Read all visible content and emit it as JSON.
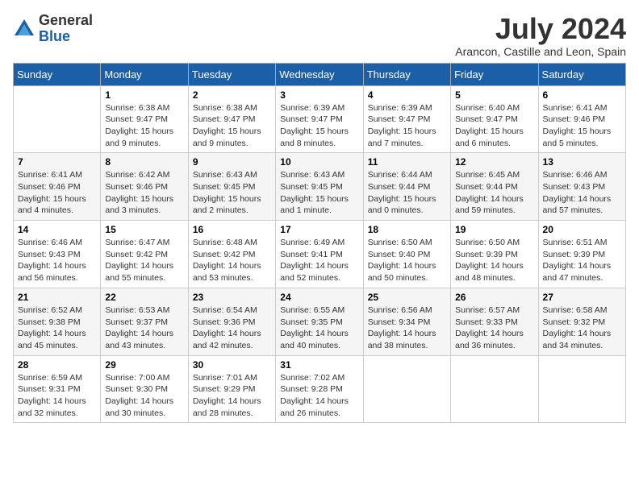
{
  "logo": {
    "general": "General",
    "blue": "Blue"
  },
  "header": {
    "month_year": "July 2024",
    "location": "Arancon, Castille and Leon, Spain"
  },
  "weekdays": [
    "Sunday",
    "Monday",
    "Tuesday",
    "Wednesday",
    "Thursday",
    "Friday",
    "Saturday"
  ],
  "weeks": [
    [
      {
        "day": "",
        "sunrise": "",
        "sunset": "",
        "daylight": ""
      },
      {
        "day": "1",
        "sunrise": "Sunrise: 6:38 AM",
        "sunset": "Sunset: 9:47 PM",
        "daylight": "Daylight: 15 hours and 9 minutes."
      },
      {
        "day": "2",
        "sunrise": "Sunrise: 6:38 AM",
        "sunset": "Sunset: 9:47 PM",
        "daylight": "Daylight: 15 hours and 9 minutes."
      },
      {
        "day": "3",
        "sunrise": "Sunrise: 6:39 AM",
        "sunset": "Sunset: 9:47 PM",
        "daylight": "Daylight: 15 hours and 8 minutes."
      },
      {
        "day": "4",
        "sunrise": "Sunrise: 6:39 AM",
        "sunset": "Sunset: 9:47 PM",
        "daylight": "Daylight: 15 hours and 7 minutes."
      },
      {
        "day": "5",
        "sunrise": "Sunrise: 6:40 AM",
        "sunset": "Sunset: 9:47 PM",
        "daylight": "Daylight: 15 hours and 6 minutes."
      },
      {
        "day": "6",
        "sunrise": "Sunrise: 6:41 AM",
        "sunset": "Sunset: 9:46 PM",
        "daylight": "Daylight: 15 hours and 5 minutes."
      }
    ],
    [
      {
        "day": "7",
        "sunrise": "Sunrise: 6:41 AM",
        "sunset": "Sunset: 9:46 PM",
        "daylight": "Daylight: 15 hours and 4 minutes."
      },
      {
        "day": "8",
        "sunrise": "Sunrise: 6:42 AM",
        "sunset": "Sunset: 9:46 PM",
        "daylight": "Daylight: 15 hours and 3 minutes."
      },
      {
        "day": "9",
        "sunrise": "Sunrise: 6:43 AM",
        "sunset": "Sunset: 9:45 PM",
        "daylight": "Daylight: 15 hours and 2 minutes."
      },
      {
        "day": "10",
        "sunrise": "Sunrise: 6:43 AM",
        "sunset": "Sunset: 9:45 PM",
        "daylight": "Daylight: 15 hours and 1 minute."
      },
      {
        "day": "11",
        "sunrise": "Sunrise: 6:44 AM",
        "sunset": "Sunset: 9:44 PM",
        "daylight": "Daylight: 15 hours and 0 minutes."
      },
      {
        "day": "12",
        "sunrise": "Sunrise: 6:45 AM",
        "sunset": "Sunset: 9:44 PM",
        "daylight": "Daylight: 14 hours and 59 minutes."
      },
      {
        "day": "13",
        "sunrise": "Sunrise: 6:46 AM",
        "sunset": "Sunset: 9:43 PM",
        "daylight": "Daylight: 14 hours and 57 minutes."
      }
    ],
    [
      {
        "day": "14",
        "sunrise": "Sunrise: 6:46 AM",
        "sunset": "Sunset: 9:43 PM",
        "daylight": "Daylight: 14 hours and 56 minutes."
      },
      {
        "day": "15",
        "sunrise": "Sunrise: 6:47 AM",
        "sunset": "Sunset: 9:42 PM",
        "daylight": "Daylight: 14 hours and 55 minutes."
      },
      {
        "day": "16",
        "sunrise": "Sunrise: 6:48 AM",
        "sunset": "Sunset: 9:42 PM",
        "daylight": "Daylight: 14 hours and 53 minutes."
      },
      {
        "day": "17",
        "sunrise": "Sunrise: 6:49 AM",
        "sunset": "Sunset: 9:41 PM",
        "daylight": "Daylight: 14 hours and 52 minutes."
      },
      {
        "day": "18",
        "sunrise": "Sunrise: 6:50 AM",
        "sunset": "Sunset: 9:40 PM",
        "daylight": "Daylight: 14 hours and 50 minutes."
      },
      {
        "day": "19",
        "sunrise": "Sunrise: 6:50 AM",
        "sunset": "Sunset: 9:39 PM",
        "daylight": "Daylight: 14 hours and 48 minutes."
      },
      {
        "day": "20",
        "sunrise": "Sunrise: 6:51 AM",
        "sunset": "Sunset: 9:39 PM",
        "daylight": "Daylight: 14 hours and 47 minutes."
      }
    ],
    [
      {
        "day": "21",
        "sunrise": "Sunrise: 6:52 AM",
        "sunset": "Sunset: 9:38 PM",
        "daylight": "Daylight: 14 hours and 45 minutes."
      },
      {
        "day": "22",
        "sunrise": "Sunrise: 6:53 AM",
        "sunset": "Sunset: 9:37 PM",
        "daylight": "Daylight: 14 hours and 43 minutes."
      },
      {
        "day": "23",
        "sunrise": "Sunrise: 6:54 AM",
        "sunset": "Sunset: 9:36 PM",
        "daylight": "Daylight: 14 hours and 42 minutes."
      },
      {
        "day": "24",
        "sunrise": "Sunrise: 6:55 AM",
        "sunset": "Sunset: 9:35 PM",
        "daylight": "Daylight: 14 hours and 40 minutes."
      },
      {
        "day": "25",
        "sunrise": "Sunrise: 6:56 AM",
        "sunset": "Sunset: 9:34 PM",
        "daylight": "Daylight: 14 hours and 38 minutes."
      },
      {
        "day": "26",
        "sunrise": "Sunrise: 6:57 AM",
        "sunset": "Sunset: 9:33 PM",
        "daylight": "Daylight: 14 hours and 36 minutes."
      },
      {
        "day": "27",
        "sunrise": "Sunrise: 6:58 AM",
        "sunset": "Sunset: 9:32 PM",
        "daylight": "Daylight: 14 hours and 34 minutes."
      }
    ],
    [
      {
        "day": "28",
        "sunrise": "Sunrise: 6:59 AM",
        "sunset": "Sunset: 9:31 PM",
        "daylight": "Daylight: 14 hours and 32 minutes."
      },
      {
        "day": "29",
        "sunrise": "Sunrise: 7:00 AM",
        "sunset": "Sunset: 9:30 PM",
        "daylight": "Daylight: 14 hours and 30 minutes."
      },
      {
        "day": "30",
        "sunrise": "Sunrise: 7:01 AM",
        "sunset": "Sunset: 9:29 PM",
        "daylight": "Daylight: 14 hours and 28 minutes."
      },
      {
        "day": "31",
        "sunrise": "Sunrise: 7:02 AM",
        "sunset": "Sunset: 9:28 PM",
        "daylight": "Daylight: 14 hours and 26 minutes."
      },
      {
        "day": "",
        "sunrise": "",
        "sunset": "",
        "daylight": ""
      },
      {
        "day": "",
        "sunrise": "",
        "sunset": "",
        "daylight": ""
      },
      {
        "day": "",
        "sunrise": "",
        "sunset": "",
        "daylight": ""
      }
    ]
  ]
}
